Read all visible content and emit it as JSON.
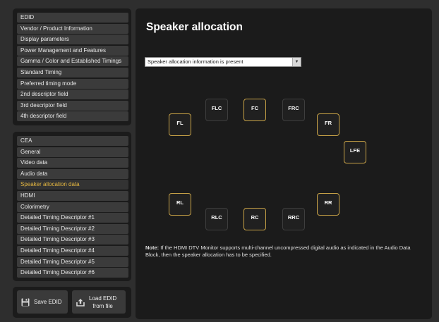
{
  "sidebar": {
    "edid_items": [
      {
        "label": "EDID"
      },
      {
        "label": "Vendor / Product Information"
      },
      {
        "label": "Display parameters"
      },
      {
        "label": "Power Management and Features"
      },
      {
        "label": "Gamma / Color and Established Timings"
      },
      {
        "label": "Standard Timing"
      },
      {
        "label": "Preferred timing mode"
      },
      {
        "label": "2nd descriptor field"
      },
      {
        "label": "3rd descriptor field"
      },
      {
        "label": "4th descriptor field"
      }
    ],
    "cea_items": [
      {
        "label": "CEA"
      },
      {
        "label": "General"
      },
      {
        "label": "Video data"
      },
      {
        "label": "Audio data"
      },
      {
        "label": "Speaker allocation data",
        "active": true
      },
      {
        "label": "HDMI"
      },
      {
        "label": "Colorimetry"
      },
      {
        "label": "Detailed Timing Descriptor #1"
      },
      {
        "label": "Detailed Timing Descriptor #2"
      },
      {
        "label": "Detailed Timing Descriptor #3"
      },
      {
        "label": "Detailed Timing Descriptor #4"
      },
      {
        "label": "Detailed Timing Descriptor #5"
      },
      {
        "label": "Detailed Timing Descriptor #6"
      }
    ],
    "save_label": "Save EDID",
    "load_label_line1": "Load EDID",
    "load_label_line2": "from file"
  },
  "main": {
    "title": "Speaker allocation",
    "select_value": "Speaker allocation information is present",
    "speakers": [
      {
        "id": "FL",
        "label": "FL",
        "selected": true
      },
      {
        "id": "FLC",
        "label": "FLC",
        "selected": false
      },
      {
        "id": "FC",
        "label": "FC",
        "selected": true
      },
      {
        "id": "FRC",
        "label": "FRC",
        "selected": false
      },
      {
        "id": "FR",
        "label": "FR",
        "selected": true
      },
      {
        "id": "LFE",
        "label": "LFE",
        "selected": true
      },
      {
        "id": "RL",
        "label": "RL",
        "selected": true
      },
      {
        "id": "RLC",
        "label": "RLC",
        "selected": false
      },
      {
        "id": "RC",
        "label": "RC",
        "selected": true
      },
      {
        "id": "RRC",
        "label": "RRC",
        "selected": false
      },
      {
        "id": "RR",
        "label": "RR",
        "selected": true
      }
    ],
    "note_label": "Note:",
    "note_text": " If the HDMI DTV Monitor supports multi-channel uncompressed digital audio as indicated in the Audio Data Block, then the speaker allocation has to be specified."
  },
  "colors": {
    "accent": "#e5b740",
    "speaker_selected_border": "#c9a347",
    "panel_bg": "#1b1b1b",
    "window_bg": "#2e2e2e",
    "nav_item_bg": "#3b3b3b"
  },
  "icons": {
    "save": "floppy-disk-icon",
    "load": "upload-file-icon",
    "dropdown": "chevron-down-icon"
  }
}
